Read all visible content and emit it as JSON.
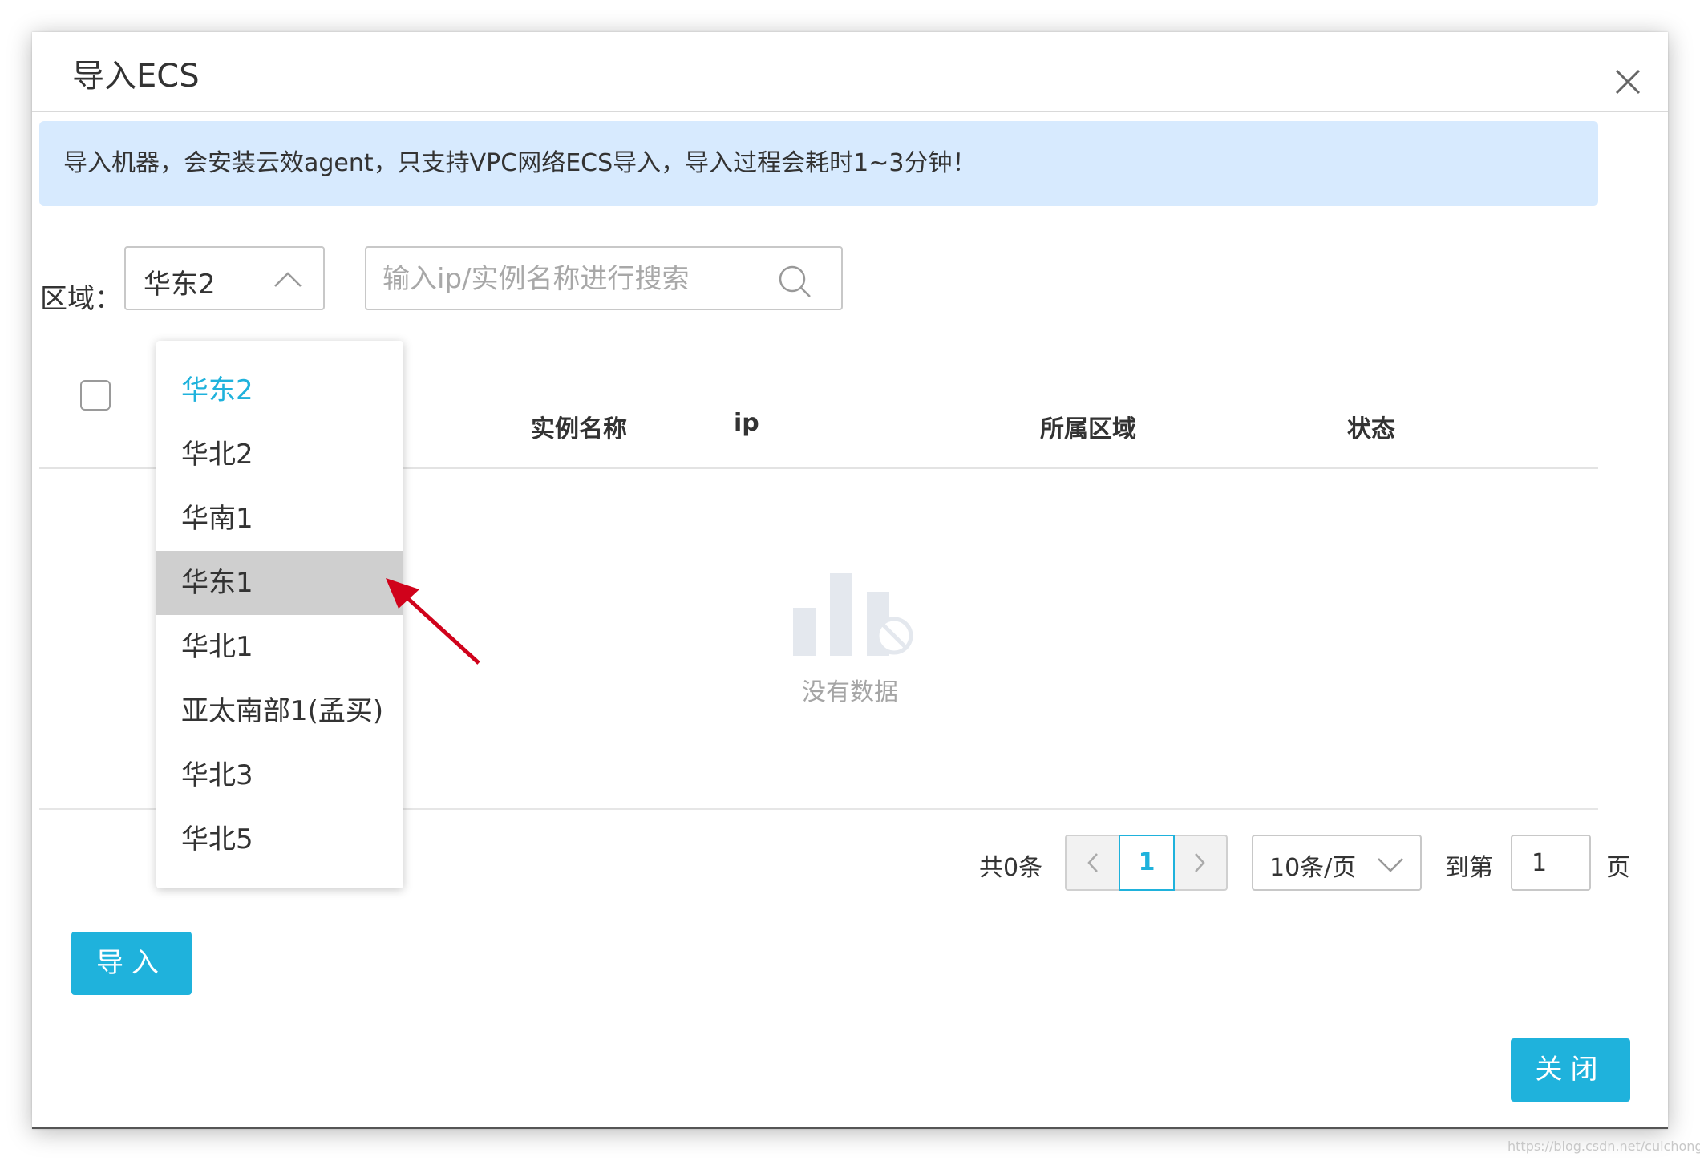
{
  "dialog": {
    "title": "导入ECS",
    "close_icon": "close-icon"
  },
  "notice": {
    "text": "导入机器，会安装云效agent，只支持VPC网络ECS导入，导入过程会耗时1~3分钟！"
  },
  "filter": {
    "region_label": "区域：",
    "region_value": "华东2",
    "search_placeholder": "输入ip/实例名称进行搜索",
    "search_value": ""
  },
  "table": {
    "columns": [
      "实例名称",
      "ip",
      "所属区域",
      "状态"
    ],
    "rows": [],
    "empty_text": "没有数据"
  },
  "region_dropdown": {
    "options": [
      "华东2",
      "华北2",
      "华南1",
      "华东1",
      "华北1",
      "亚太南部1(孟买)",
      "华北3",
      "华北5"
    ],
    "selected": "华东2",
    "hovered": "华东1"
  },
  "pagination": {
    "total_label": "共0条",
    "current_page": "1",
    "page_size": "10条/页",
    "goto_label": "到第",
    "goto_value": "1",
    "page_suffix": "页"
  },
  "buttons": {
    "import_label": "导入",
    "close_label": "关闭"
  },
  "colors": {
    "accent": "#1fb2dc",
    "notice_bg": "#d7eafe",
    "hover_bg": "#cfcfcf",
    "annotation_arrow": "#d0021b"
  },
  "watermark": "https://blog.csdn.net/cuichongxin"
}
